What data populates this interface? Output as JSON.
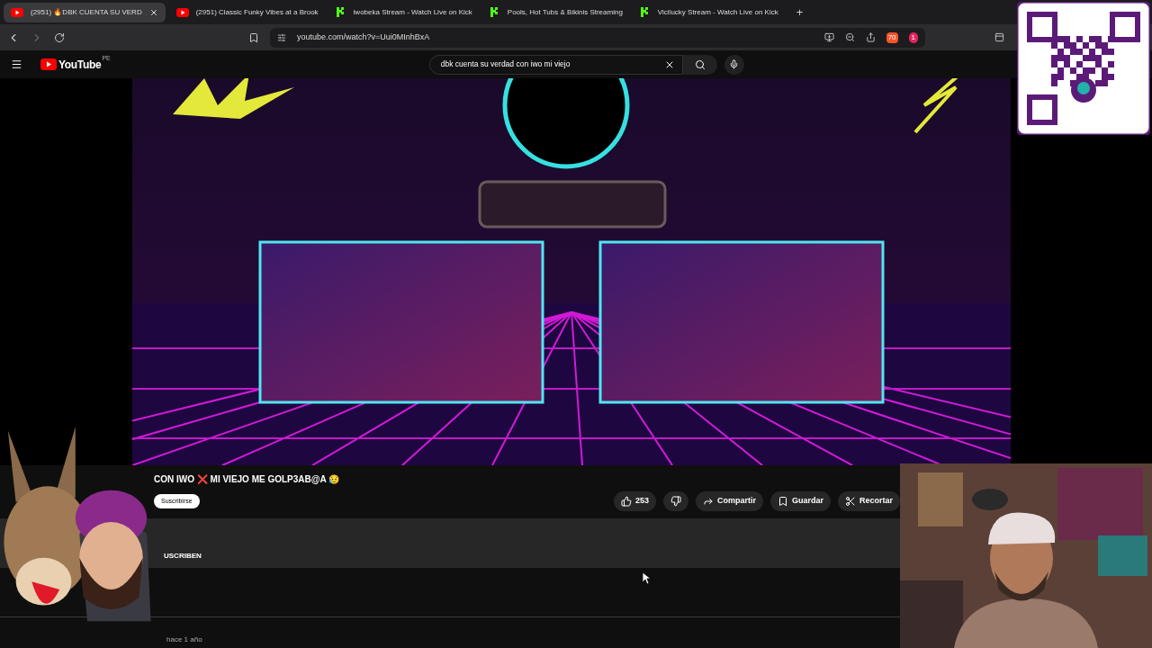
{
  "browser": {
    "tabs": [
      {
        "title": "(2951) 🔥DBK CUENTA SU VERD",
        "kind": "youtube",
        "selected": true
      },
      {
        "title": "(2951) Classic Funky Vibes at a Brook",
        "kind": "youtube",
        "selected": false
      },
      {
        "title": "iwobeka Stream - Watch Live on Kick",
        "kind": "kick",
        "selected": false
      },
      {
        "title": "Pools, Hot Tubs & Bikinis Streaming",
        "kind": "kick",
        "selected": false
      },
      {
        "title": "Vicilucky Stream - Watch Live on Kick",
        "kind": "kick",
        "selected": false
      }
    ],
    "new_tab": "+",
    "url": "youtube.com/watch?v=Uui0MInhBxA",
    "shield_count": "70",
    "alert_count": "1"
  },
  "youtube": {
    "logo": "YouTube",
    "region": "PE",
    "search": {
      "value": "dbk cuenta su verdad con iwo mi viejo"
    }
  },
  "video_info": {
    "title": "CON IWO ❌ MI VIEJO ME GOLP3AB@A 😥",
    "subscribe": "Suscribirse",
    "actions": [
      {
        "kind": "like",
        "label": "253"
      },
      {
        "kind": "dislike"
      },
      {
        "kind": "share",
        "label": "Compartir"
      },
      {
        "kind": "save",
        "label": "Guardar"
      },
      {
        "kind": "clip",
        "label": "Recortar"
      }
    ]
  },
  "description": {
    "text": "USCRIBEN"
  },
  "comment": {
    "time": "hace 1 año"
  }
}
